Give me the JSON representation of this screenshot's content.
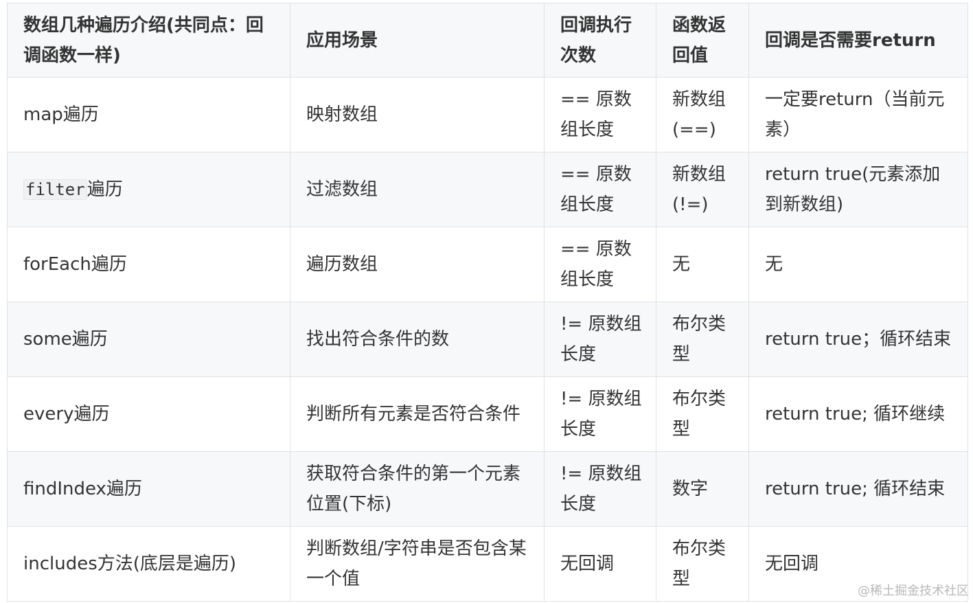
{
  "table": {
    "headers": [
      "数组几种遍历介绍(共同点：回调函数一样)",
      "应用场景",
      "回调执行次数",
      "函数返回值",
      "回调是否需要return"
    ],
    "rows": [
      {
        "method": "map遍历",
        "method_code": "",
        "method_suffix": "",
        "scenario": "映射数组",
        "callback_count": "== 原数组长度",
        "return_value": "新数组(==)",
        "need_return": "一定要return（当前元素）"
      },
      {
        "method": "",
        "method_code": "filter",
        "method_suffix": "遍历",
        "scenario": "过滤数组",
        "callback_count": "== 原数组长度",
        "return_value": "新数组(!=)",
        "need_return": "return  true(元素添加到新数组)"
      },
      {
        "method": "forEach遍历",
        "method_code": "",
        "method_suffix": "",
        "scenario": "遍历数组",
        "callback_count": "== 原数组长度",
        "return_value": "无",
        "need_return": "无"
      },
      {
        "method": "some遍历",
        "method_code": "",
        "method_suffix": "",
        "scenario": "找出符合条件的数",
        "callback_count": "!= 原数组长度",
        "return_value": "布尔类型",
        "need_return": "return true；循环结束"
      },
      {
        "method": "every遍历",
        "method_code": "",
        "method_suffix": "",
        "scenario": "判断所有元素是否符合条件",
        "callback_count": "!= 原数组长度",
        "return_value": "布尔类型",
        "need_return": "return true; 循环继续"
      },
      {
        "method": "findIndex遍历",
        "method_code": "",
        "method_suffix": "",
        "scenario": "获取符合条件的第一个元素位置(下标)",
        "callback_count": "!= 原数组长度",
        "return_value": "数字",
        "need_return": "return true; 循环结束"
      },
      {
        "method": "includes方法(底层是遍历)",
        "method_code": "",
        "method_suffix": "",
        "scenario": "判断数组/字符串是否包含某一个值",
        "callback_count": "无回调",
        "return_value": "布尔类型",
        "need_return": "无回调"
      }
    ]
  },
  "watermark": "@稀土掘金技术社区"
}
